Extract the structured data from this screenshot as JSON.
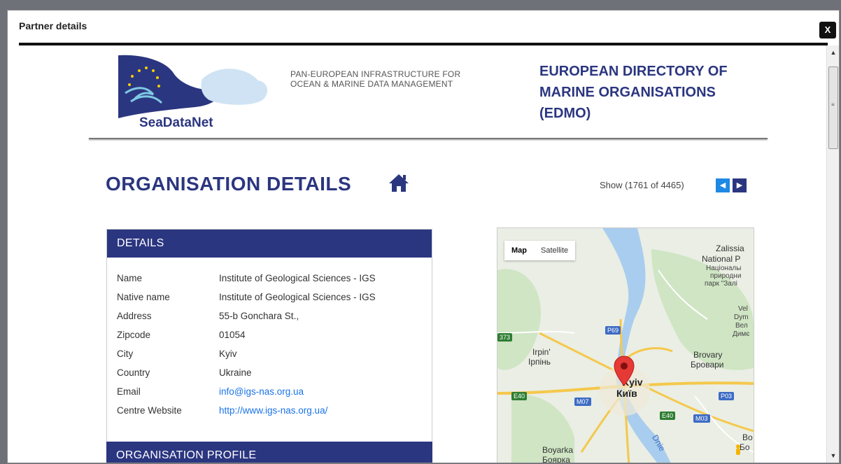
{
  "dialog": {
    "title": "Partner details",
    "close_label": "X"
  },
  "header": {
    "logo_text": "SeaDataNet",
    "tagline_line1": "PAN-EUROPEAN INFRASTRUCTURE FOR",
    "tagline_line2": "OCEAN & MARINE DATA MANAGEMENT",
    "edmo_line1": "EUROPEAN DIRECTORY OF",
    "edmo_line2": "MARINE ORGANISATIONS",
    "edmo_line3": "(EDMO)"
  },
  "main": {
    "page_title": "ORGANISATION DETAILS",
    "show_count": "Show (1761 of 4465)",
    "prev_label": "◀",
    "next_label": "▶"
  },
  "details": {
    "heading": "DETAILS",
    "rows": [
      {
        "label": "Name",
        "value": "Institute of Geological Sciences - IGS"
      },
      {
        "label": "Native name",
        "value": "Institute of Geological Sciences - IGS"
      },
      {
        "label": "Address",
        "value": "55-b Gonchara St.,"
      },
      {
        "label": "Zipcode",
        "value": "01054"
      },
      {
        "label": "City",
        "value": "Kyiv"
      },
      {
        "label": "Country",
        "value": "Ukraine"
      },
      {
        "label": "Email",
        "value": "info@igs-nas.org.ua"
      },
      {
        "label": "Centre Website",
        "value": "http://www.igs-nas.org.ua/"
      }
    ]
  },
  "profile": {
    "heading": "ORGANISATION PROFILE"
  },
  "map": {
    "tabs": [
      "Map",
      "Satellite"
    ],
    "labels": {
      "zalissia1": "Zalissia",
      "zalissia2": "National P",
      "nac1": "Націоналы",
      "nac2": "природни",
      "nac3": "парк \"Залі",
      "vel1": "Vel",
      "vel2": "Dym",
      "vel3": "Вел",
      "vel4": "Димє",
      "irpin1": "Irpin'",
      "irpin2": "Ірпінь",
      "brovary1": "Brovary",
      "brovary2": "Бровари",
      "kyiv1": "Kyiv",
      "kyiv2": "Київ",
      "boyarka1": "Boyarka",
      "boyarka2": "Боярка",
      "dnie": "Dnie",
      "bo1": "Bo",
      "bo2": "Бо"
    },
    "roads": {
      "p69": "P69",
      "r373": "373",
      "e40a": "E40",
      "m07": "M07",
      "p03": "P03",
      "e40b": "E40",
      "m03": "M03"
    }
  }
}
